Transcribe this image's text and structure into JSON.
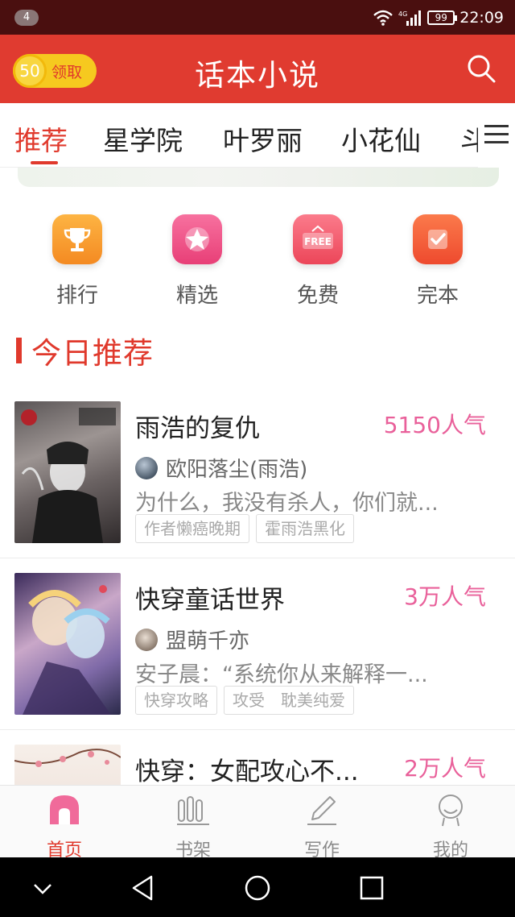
{
  "status_bar": {
    "notification_count": "4",
    "network_label": "4G",
    "battery": "99",
    "time": "22:09"
  },
  "header": {
    "coin_value": "50",
    "coin_label": "领取",
    "title": "话本小说",
    "search_icon": "search-icon"
  },
  "tabs": [
    {
      "label": "推荐",
      "active": true
    },
    {
      "label": "星学院",
      "active": false
    },
    {
      "label": "叶罗丽",
      "active": false
    },
    {
      "label": "小花仙",
      "active": false
    },
    {
      "label": "斗",
      "active": false
    }
  ],
  "quick_links": [
    {
      "label": "排行",
      "icon": "trophy-icon",
      "color": "#f79a2c"
    },
    {
      "label": "精选",
      "icon": "star-icon",
      "color": "#ee4f83"
    },
    {
      "label": "免费",
      "icon": "free-icon",
      "color": "#f0546b"
    },
    {
      "label": "完本",
      "icon": "check-icon",
      "color": "#f25a3c"
    }
  ],
  "section": {
    "title": "今日推荐"
  },
  "books": [
    {
      "title": "雨浩的复仇",
      "popularity": "5150人气",
      "author": "欧阳落尘(雨浩)",
      "description": "为什么，我没有杀人，你们就...",
      "tags": [
        "作者懒癌晚期",
        "霍雨浩黑化"
      ]
    },
    {
      "title": "快穿童话世界",
      "popularity": "3万人气",
      "author": "盟萌千亦",
      "description": "安子晨：“系统你从来解释一...",
      "tags": [
        "快穿攻略",
        "攻受　耽美纯爱"
      ]
    },
    {
      "title": "快穿：女配攻心不...",
      "popularity": "2万人气",
      "author": "",
      "description": "",
      "tags": []
    }
  ],
  "bottom_nav": [
    {
      "label": "首页",
      "icon": "home-icon",
      "active": true
    },
    {
      "label": "书架",
      "icon": "bookshelf-icon",
      "active": false
    },
    {
      "label": "写作",
      "icon": "pencil-icon",
      "active": false
    },
    {
      "label": "我的",
      "icon": "profile-icon",
      "active": false
    }
  ],
  "colors": {
    "brand_red": "#e0392c",
    "popularity_pink": "#e9609a",
    "status_bar": "#4a0f0f"
  }
}
